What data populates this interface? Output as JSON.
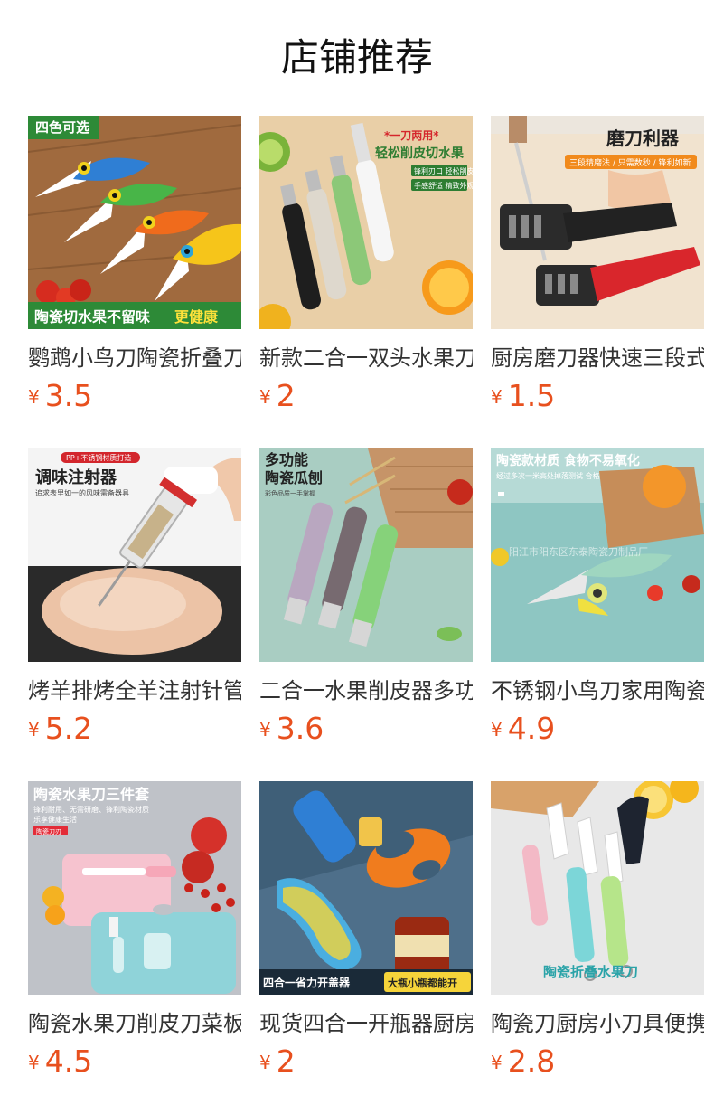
{
  "page": {
    "title": "店铺推荐"
  },
  "currency_symbol": "¥",
  "products": [
    {
      "name": "鹦鹉小鸟刀陶瓷折叠刀",
      "price": "3.5",
      "image_text": {
        "badge": "四色可选",
        "caption_main": "陶瓷切水果不留味",
        "caption_accent": "更健康"
      }
    },
    {
      "name": "新款二合一双头水果刀",
      "price": "2",
      "image_text": {
        "top": "*一刀两用*",
        "headline": "轻松削皮切水果",
        "tag1": "锋利刃口 轻松削皮",
        "tag2": "手感舒适 精致外观"
      }
    },
    {
      "name": "厨房磨刀器快速三段式",
      "price": "1.5",
      "image_text": {
        "headline": "磨刀利器",
        "subline": "三段精磨法 / 只需数秒 / 锋利如新"
      }
    },
    {
      "name": "烤羊排烤全羊注射针管",
      "price": "5.2",
      "image_text": {
        "badge": "PP+不锈钢材质打造",
        "headline": "调味注射器",
        "sub": "追求表里如一的风味需备器具"
      }
    },
    {
      "name": "二合一水果削皮器多功能",
      "price": "3.6",
      "image_text": {
        "headline1": "多功能",
        "headline2": "陶瓷瓜刨",
        "sub": "彩色品质一手掌握"
      }
    },
    {
      "name": "不锈钢小鸟刀家用陶瓷刀",
      "price": "4.9",
      "image_text": {
        "headline": "陶瓷款材质 食物不易氧化",
        "sub": "经过多次一米高处掉落测试 合格",
        "watermark": "阳江市阳东区东泰陶瓷刀制品厂"
      }
    },
    {
      "name": "陶瓷水果刀削皮刀菜板套装",
      "price": "4.5",
      "image_text": {
        "headline": "陶瓷水果刀三件套",
        "sub1": "锋利耐用、无需研磨、锋利陶瓷材质",
        "sub2": "乐享健康生活",
        "badge": "陶瓷刀刃"
      }
    },
    {
      "name": "现货四合一开瓶器厨房工具",
      "price": "2",
      "image_text": {
        "caption_left": "四合一省力开盖器",
        "caption_right": "大瓶小瓶都能开"
      }
    },
    {
      "name": "陶瓷刀厨房小刀具便携",
      "price": "2.8",
      "image_text": {
        "headline": "陶瓷折叠水果刀"
      }
    }
  ]
}
